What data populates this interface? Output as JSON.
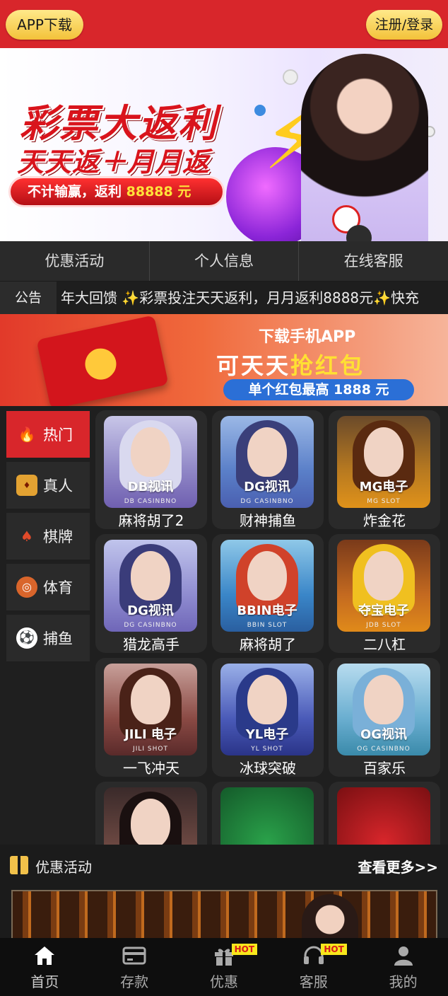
{
  "header": {
    "app_download": "APP下载",
    "login": "注册/登录"
  },
  "hero": {
    "title": "彩票大返利",
    "subtitle": "天天返＋月月返",
    "promo_prefix": "不计输赢，返利",
    "promo_amount": "88888 元"
  },
  "quick_nav": [
    "优惠活动",
    "个人信息",
    "在线客服"
  ],
  "notice": {
    "tag": "公告",
    "text": "年大回馈 ✨彩票投注天天返利，月月返利8888元✨快充"
  },
  "app_banner": {
    "line1": "下载手机APP",
    "line2_a": "可天天",
    "line2_b": "抢红包",
    "line3": "单个红包最高 1888 元"
  },
  "categories": [
    {
      "label": "热门",
      "icon": "fire-icon"
    },
    {
      "label": "真人",
      "icon": "live-dealer-icon"
    },
    {
      "label": "棋牌",
      "icon": "chess-card-icon"
    },
    {
      "label": "体育",
      "icon": "sports-icon"
    },
    {
      "label": "捕鱼",
      "icon": "fishing-icon"
    }
  ],
  "games": [
    {
      "name": "麻将胡了2",
      "brand": "DB视讯",
      "sub": "DB CASINBNO"
    },
    {
      "name": "财神捕鱼",
      "brand": "DG视讯",
      "sub": "DG CASINBNO"
    },
    {
      "name": "炸金花",
      "brand": "MG电子",
      "sub": "MG SLOT"
    },
    {
      "name": "猎龙高手",
      "brand": "DG视讯",
      "sub": "DG CASINBNO"
    },
    {
      "name": "麻将胡了",
      "brand": "BBIN电子",
      "sub": "BBIN SLOT"
    },
    {
      "name": "二八杠",
      "brand": "夺宝电子",
      "sub": "JDB SLOT"
    },
    {
      "name": "一飞冲天",
      "brand": "JILI 电子",
      "sub": "JILI SHOT"
    },
    {
      "name": "冰球突破",
      "brand": "YL电子",
      "sub": "YL SHOT"
    },
    {
      "name": "百家乐",
      "brand": "OG视讯",
      "sub": "OG CASINBNO"
    },
    {
      "name": "",
      "brand": "",
      "sub": ""
    },
    {
      "name": "",
      "brand": "",
      "sub": ""
    },
    {
      "name": "",
      "brand": "",
      "sub": ""
    }
  ],
  "promotions": {
    "title": "优惠活动",
    "more": "查看更多>>"
  },
  "tabs": [
    {
      "label": "首页",
      "icon": "home-icon"
    },
    {
      "label": "存款",
      "icon": "card-icon"
    },
    {
      "label": "优惠",
      "icon": "gift-icon",
      "badge": "HOT"
    },
    {
      "label": "客服",
      "icon": "headset-icon",
      "badge": "HOT"
    },
    {
      "label": "我的",
      "icon": "user-icon"
    }
  ],
  "colors": {
    "brand_red": "#d8262b",
    "gold": "#f3c23a",
    "dark_bg": "#1b1b1b"
  }
}
